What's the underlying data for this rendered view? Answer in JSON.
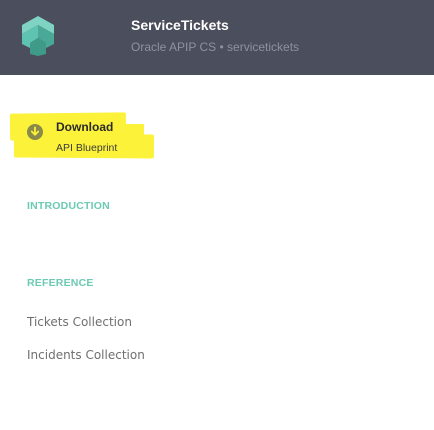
{
  "header": {
    "logo_icon": "apiary-logo-icon",
    "title": "ServiceTickets",
    "subtitle": "Oracle APIP CS • servicetickets",
    "background": "#4b4e5c",
    "logo_color": "#5ec3b0"
  },
  "download": {
    "icon": "download-icon",
    "label": "Download",
    "sublabel": "API Blueprint",
    "highlight_color": "#fdf23a"
  },
  "nav": {
    "introduction": "INTRODUCTION",
    "reference": "REFERENCE",
    "accent": "#6ccab3",
    "items": [
      {
        "label": "Tickets Collection"
      },
      {
        "label": "Incidents Collection"
      }
    ]
  }
}
